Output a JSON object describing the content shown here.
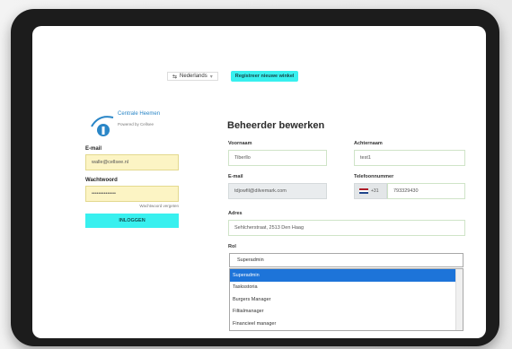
{
  "topbar": {
    "language": "Nederlands",
    "register_label": "Registreer nieuwe winkel"
  },
  "brand": {
    "name": "Centrale Heemen",
    "powered_by": "Powered by Cellsee"
  },
  "login": {
    "email_label": "E-mail",
    "email_value": "walle@cellsee.nl",
    "password_label": "Wachtwoord",
    "password_value": "••••••••••••••",
    "forgot_label": "Wachtwoord vergeten",
    "submit_label": "INLOGGEN"
  },
  "form": {
    "title": "Beheerder bewerken",
    "first_name_label": "Voornaam",
    "first_name_value": "Tiberllo",
    "last_name_label": "Achternaam",
    "last_name_value": "test1",
    "email_label": "E-mail",
    "email_value": "tdjowfil@dilvemark.com",
    "phone_label": "Telefoonnummer",
    "phone_prefix": "+31",
    "phone_value": "793329430",
    "address_label": "Adres",
    "address_value": "Sehlcherstraat, 2513 Den Haag",
    "role_label": "Rol",
    "role_value": "Superadmin",
    "role_options": [
      "Superadmin",
      "Tasksstoria",
      "Burgers Manager",
      "Filtialmanager",
      "Financieel manager"
    ],
    "selected_index": 0
  },
  "colors": {
    "accent": "#38f0ef",
    "autofill": "#fcf4c4",
    "selected_option": "#1d74d9",
    "brand_blue": "#2a86c7"
  }
}
